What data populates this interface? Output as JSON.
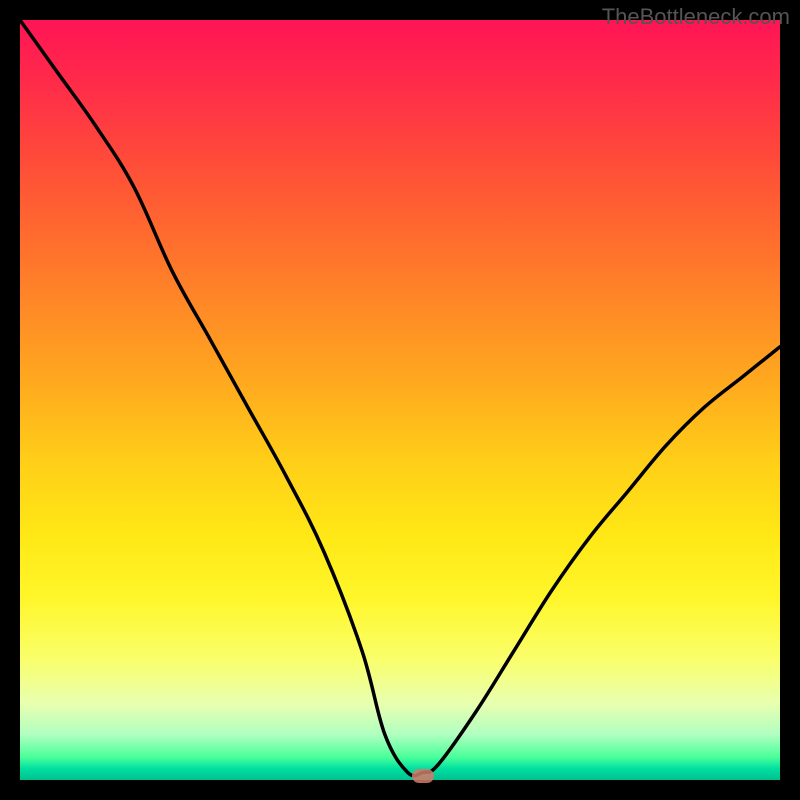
{
  "watermark": "TheBottleneck.com",
  "colors": {
    "top": "#ff1455",
    "mid": "#ffce18",
    "bottom": "#00c090",
    "curve": "#000000",
    "marker": "#d47a6a"
  },
  "chart_data": {
    "type": "line",
    "title": "",
    "xlabel": "",
    "ylabel": "",
    "xlim": [
      0,
      100
    ],
    "ylim": [
      0,
      100
    ],
    "grid": false,
    "legend": false,
    "series": [
      {
        "name": "bottleneck-curve",
        "x": [
          0,
          5,
          10,
          15,
          20,
          25,
          30,
          35,
          40,
          45,
          48,
          51,
          53,
          55,
          60,
          65,
          70,
          75,
          80,
          85,
          90,
          95,
          100
        ],
        "y": [
          100,
          93,
          86,
          78,
          67,
          58,
          49,
          40,
          30,
          17,
          6,
          1,
          1,
          2,
          9,
          17,
          25,
          32,
          38,
          44,
          49,
          53,
          57
        ]
      }
    ],
    "marker": {
      "x": 53,
      "y": 0.5
    },
    "gradient_stops": [
      {
        "pos": 0,
        "meaning": "high-bottleneck",
        "color": "#ff1455"
      },
      {
        "pos": 50,
        "meaning": "mid",
        "color": "#ffce18"
      },
      {
        "pos": 100,
        "meaning": "no-bottleneck",
        "color": "#00c090"
      }
    ]
  }
}
